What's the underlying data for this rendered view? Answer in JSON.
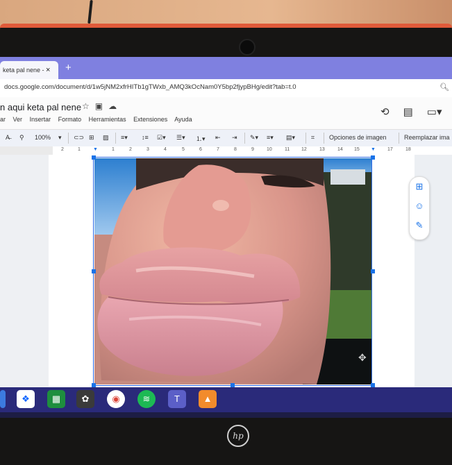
{
  "browser": {
    "tab_title": "keta pal nene -",
    "tab_close": "×",
    "new_tab": "+",
    "url": "docs.google.com/document/d/1w5jNM2xfrHITb1gTWxb_AMQ3kOcNam0Y5bp2fjypBHg/edit?tab=t.0"
  },
  "doc": {
    "title": "n aqui keta pal nene",
    "menu": [
      "ar",
      "Ver",
      "Insertar",
      "Formato",
      "Herramientas",
      "Extensiones",
      "Ayuda"
    ]
  },
  "toolbar": {
    "zoom": "100%",
    "image_options": "Opciones de imagen",
    "replace_image": "Reemplazar ima"
  },
  "ruler": {
    "ticks": [
      "2",
      "1",
      "1",
      "2",
      "3",
      "4",
      "5",
      "6",
      "7",
      "8",
      "9",
      "10",
      "11",
      "12",
      "13",
      "14",
      "15",
      "16",
      "17",
      "18"
    ]
  },
  "device": {
    "brand": "hp"
  },
  "colors": {
    "tabbar": "#7f80e0",
    "selection": "#1a73e8",
    "shelf": "#2a2a7a"
  },
  "icons": {
    "shelf": [
      "dropbox-icon",
      "sheets-icon",
      "photos-icon",
      "chrome-icon",
      "spotify-icon",
      "teams-icon",
      "pixlr-icon"
    ]
  }
}
